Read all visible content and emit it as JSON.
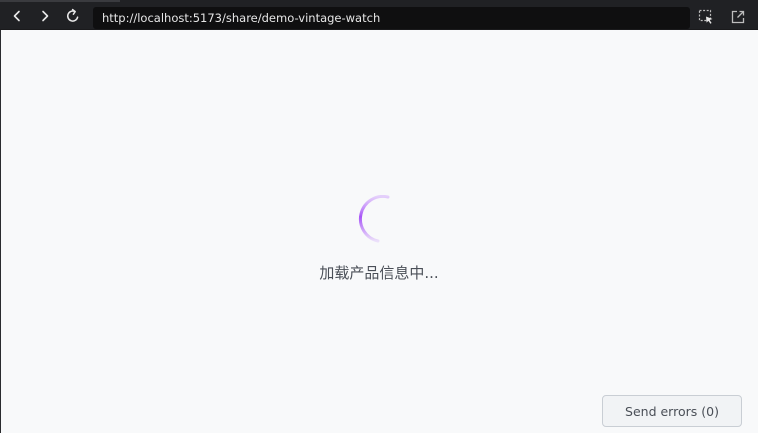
{
  "browser": {
    "url": "http://localhost:5173/share/demo-vintage-watch",
    "icons": [
      "back-icon",
      "forward-icon",
      "reload-icon",
      "select-element-icon",
      "open-external-icon"
    ]
  },
  "page": {
    "loading_text": "加载产品信息中...",
    "spinner_color": "#a855f7"
  },
  "footer": {
    "send_errors_label": "Send errors (0)"
  }
}
